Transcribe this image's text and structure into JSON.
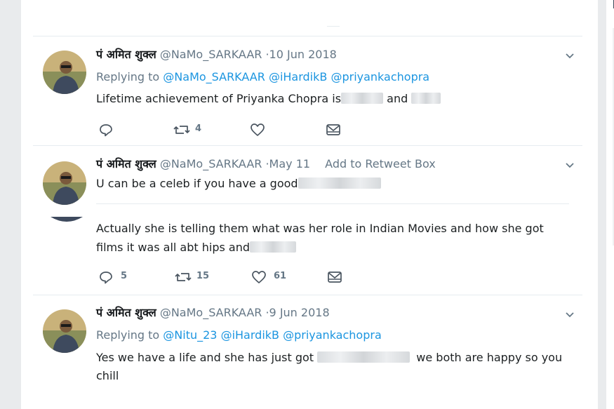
{
  "tweets": [
    {
      "name": "पं अमित शुक्ल",
      "handle": "@NaMo_SARKAAR",
      "date": "·10 Jun 2018",
      "replying_prefix": "Replying to",
      "replying_to": [
        "@NaMo_SARKAAR",
        "@iHardikB",
        "@priyankachopra"
      ],
      "text_parts": [
        "Lifetime achievement of Priyanka Chopra is",
        "and"
      ],
      "actions": {
        "reply": "",
        "retweet": "4",
        "like": ""
      }
    },
    {
      "name": "पं अमित शुक्ल",
      "handle": "@NaMo_SARKAAR",
      "date": "·May 11",
      "extra": "Add to Retweet Box",
      "text": "U can be a celeb if you have a good",
      "quoted_text_line1": "Actually she is telling them what was her role in Indian Movies and how she got",
      "quoted_text_line2": "films it was all abt hips and",
      "actions": {
        "reply": "5",
        "retweet": "15",
        "like": "61"
      }
    },
    {
      "name": "पं अमित शुक्ल",
      "handle": "@NaMo_SARKAAR",
      "date": "·9 Jun 2018",
      "replying_prefix": "Replying to",
      "replying_to": [
        "@Nitu_23",
        "@iHardikB",
        "@priyankachopra"
      ],
      "text_line1_a": "Yes we have a life and she has just got",
      "text_line1_b": "we both are happy so you",
      "text_line2": "chill",
      "actions": {
        "reply": "",
        "retweet": "",
        "like": ""
      }
    }
  ],
  "colors": {
    "link": "#1b95e0",
    "muted": "#657786",
    "text": "#1c2022"
  },
  "icons": [
    "chevron-down-icon",
    "reply-icon",
    "retweet-icon",
    "like-icon",
    "message-icon"
  ]
}
